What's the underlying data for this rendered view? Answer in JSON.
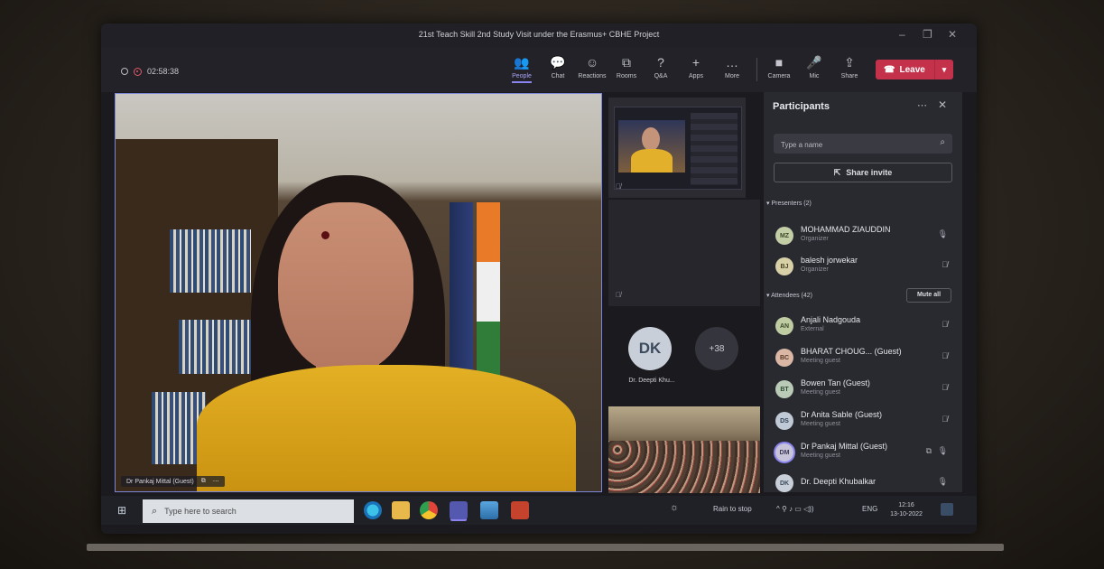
{
  "window": {
    "title": "21st Teach Skill 2nd Study Visit under the Erasmus+ CBHE Project",
    "controls": [
      "–",
      "❐",
      "✕"
    ]
  },
  "toolbar": {
    "timer": "02:58:38",
    "buttons": [
      {
        "label": "People",
        "icon": "people-icon",
        "glyph": "👥"
      },
      {
        "label": "Chat",
        "icon": "chat-icon",
        "glyph": "💬"
      },
      {
        "label": "Reactions",
        "icon": "reactions-icon",
        "glyph": "☺"
      },
      {
        "label": "Rooms",
        "icon": "rooms-icon",
        "glyph": "⧉"
      },
      {
        "label": "Q&A",
        "icon": "qa-icon",
        "glyph": "?"
      },
      {
        "label": "Apps",
        "icon": "apps-icon",
        "glyph": "+"
      },
      {
        "label": "More",
        "icon": "more-icon",
        "glyph": "…"
      },
      {
        "label": "Camera",
        "icon": "camera-icon",
        "glyph": "■"
      },
      {
        "label": "Mic",
        "icon": "mic-icon",
        "glyph": "🎤"
      },
      {
        "label": "Share",
        "icon": "share-icon",
        "glyph": "⇪"
      }
    ],
    "leave_label": "Leave"
  },
  "stage": {
    "name_tag": "Dr Pankaj Mittal (Guest)"
  },
  "gallery": {
    "dk_initials": "DK",
    "dk_label": "Dr. Deepti Khu...",
    "more_count": "+38"
  },
  "participants_panel": {
    "title": "Participants",
    "search_placeholder": "Type a name",
    "share_invite_label": "Share invite",
    "presenters_header": "Presenters (2)",
    "attendees_header": "Attendees (42)",
    "mute_all_label": "Mute all",
    "presenters": [
      {
        "initials": "MZ",
        "name": "MOHAMMAD ZIAUDDIN",
        "role": "Organizer",
        "avatar_bg": "#c3cda6",
        "mic": "mic-icon"
      },
      {
        "initials": "BJ",
        "name": "balesh jorwekar",
        "role": "Organizer",
        "avatar_bg": "#d8d0a7",
        "mic": "mic-off-icon"
      }
    ],
    "attendees": [
      {
        "initials": "AN",
        "name": "Anjali Nadgouda",
        "role": "External",
        "avatar_bg": "#bfcca2",
        "mic": "mic-off-icon"
      },
      {
        "initials": "BC",
        "name": "BHARAT CHOUG... (Guest)",
        "role": "Meeting guest",
        "avatar_bg": "#d9b7a4",
        "mic": "mic-off-icon"
      },
      {
        "initials": "BT",
        "name": "Bowen Tan (Guest)",
        "role": "Meeting guest",
        "avatar_bg": "#b9cbb6",
        "mic": "mic-off-icon"
      },
      {
        "initials": "DS",
        "name": "Dr Anita Sable (Guest)",
        "role": "Meeting guest",
        "avatar_bg": "#bfcad6",
        "mic": "mic-off-icon"
      },
      {
        "initials": "DM",
        "name": "Dr Pankaj Mittal (Guest)",
        "role": "Meeting guest",
        "avatar_bg": "#c7c4d9",
        "mic": "mic-icon"
      },
      {
        "initials": "DK",
        "name": "Dr. Deepti Khubalkar",
        "role": "",
        "avatar_bg": "#c9cfd8",
        "mic": "mic-icon"
      }
    ]
  },
  "taskbar": {
    "search_placeholder": "Type here to search",
    "weather": "Rain to stop",
    "language": "ENG",
    "time": "12:16",
    "date": "13-10-2022"
  },
  "colors": {
    "accent": "#8b84ef",
    "leave": "#c4314b",
    "panel_bg": "#292930"
  }
}
